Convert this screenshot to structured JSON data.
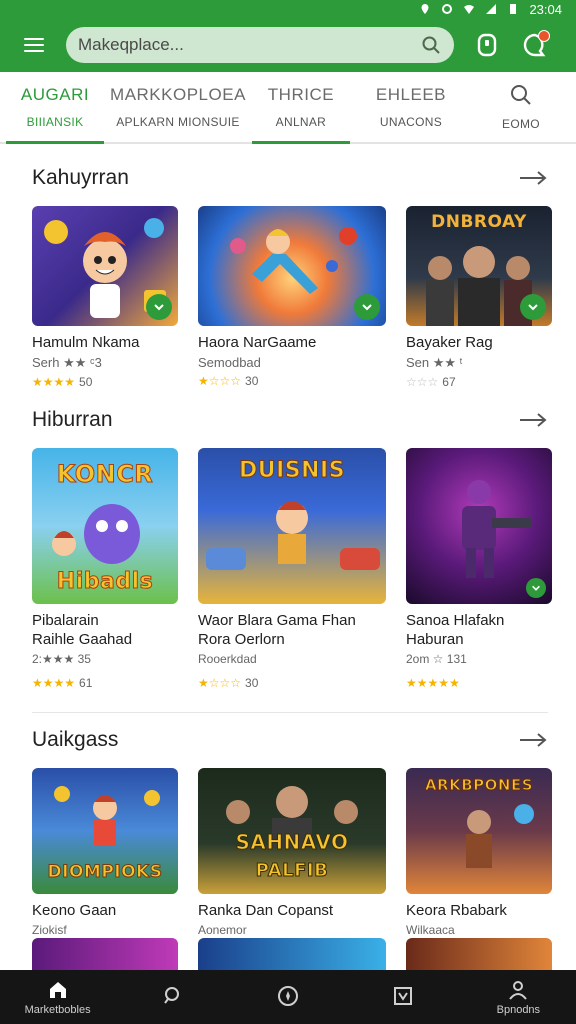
{
  "status": {
    "time": "23:04"
  },
  "appbar": {
    "search_placeholder": "Makeqplace..."
  },
  "tabs": [
    {
      "title": "AUGARI",
      "subtitle": "BIIIANSIK",
      "active": true
    },
    {
      "title": "MARKKOPLOEA",
      "subtitle": "APLKARN MIONSUIE",
      "active": false
    },
    {
      "title": "THRICE",
      "subtitle": "ANLNAR",
      "active": false
    },
    {
      "title": "EHLEEB",
      "subtitle": "UNACONS",
      "active": false
    },
    {
      "title": "",
      "subtitle": "EOMO",
      "active": false,
      "icon": "search-icon"
    }
  ],
  "sections": [
    {
      "title": "Kahuyrran",
      "cards": [
        {
          "title": "Hamulm Nkama",
          "subtitle": "Serh ★★ ᶜ3",
          "rating_text": "50",
          "stars": "★★★★",
          "art_text": "",
          "colors": [
            "#5a3fb0",
            "#f2a93b"
          ]
        },
        {
          "title": "Haora NarGaame",
          "subtitle": "Semodbad",
          "rating_text": "30",
          "stars": "★☆☆☆",
          "art_text": "",
          "colors": [
            "#2d6fd6",
            "#f07a3a"
          ]
        },
        {
          "title": "Bayaker Rag",
          "subtitle": "Sen ★★ ᵗ",
          "rating_text": "67",
          "stars": "☆☆☆",
          "art_text": "DNBROAY",
          "colors": [
            "#202a3a",
            "#d08b2a"
          ]
        }
      ]
    },
    {
      "title": "Hiburran",
      "cards": [
        {
          "title": "Pibalarain",
          "subtitle": "Raihle Gaahad",
          "rating_line": "2:★★★ 35",
          "rating_text": "61",
          "stars": "★★★★",
          "art_text": "KONCR",
          "art_text2": "Hibadls",
          "colors": [
            "#46b4e8",
            "#6cc04a"
          ]
        },
        {
          "title": "Waor Blara Gama Fhan",
          "subtitle": "Rora Oerlorn",
          "rating_line": "Rooerkdad",
          "rating_text": "30",
          "stars": "★☆☆☆",
          "art_text": "DUISNIS",
          "colors": [
            "#2a4fa8",
            "#e7b43a"
          ]
        },
        {
          "title": "Sanoa Hlafakn",
          "subtitle": "Haburan",
          "rating_line": "2om ☆ 131",
          "rating_text": "",
          "stars": "★★★★★",
          "art_text": "",
          "colors": [
            "#3a1a5a",
            "#b03ab8"
          ]
        }
      ]
    },
    {
      "title": "Uaikgass",
      "cards": [
        {
          "title": "Keono Gaan",
          "subtitle": "Ziokisf",
          "art_text": "DIOMPIOKS",
          "colors": [
            "#2a4fa8",
            "#e8a93a"
          ]
        },
        {
          "title": "Ranka Dan Copanst",
          "subtitle": "Aonemor",
          "art_text": "SAHNAVO",
          "art_text2": "PALFIB",
          "colors": [
            "#1c2a1c",
            "#c9a13a"
          ]
        },
        {
          "title": "Keora Rbabark",
          "subtitle": "Wilkaaca",
          "art_text": "ARKBPONES",
          "colors": [
            "#3a2a52",
            "#e0853a"
          ]
        }
      ]
    }
  ],
  "bottom_nav": [
    {
      "label": "Marketbobles",
      "icon": "home-icon"
    },
    {
      "label": "",
      "icon": "search-icon"
    },
    {
      "label": "",
      "icon": "compass-icon"
    },
    {
      "label": "",
      "icon": "library-icon"
    },
    {
      "label": "Bpnodns",
      "icon": "profile-icon"
    }
  ],
  "colors": {
    "primary": "#2e9b3a",
    "nav_bg": "#151515",
    "star": "#f4b400"
  }
}
